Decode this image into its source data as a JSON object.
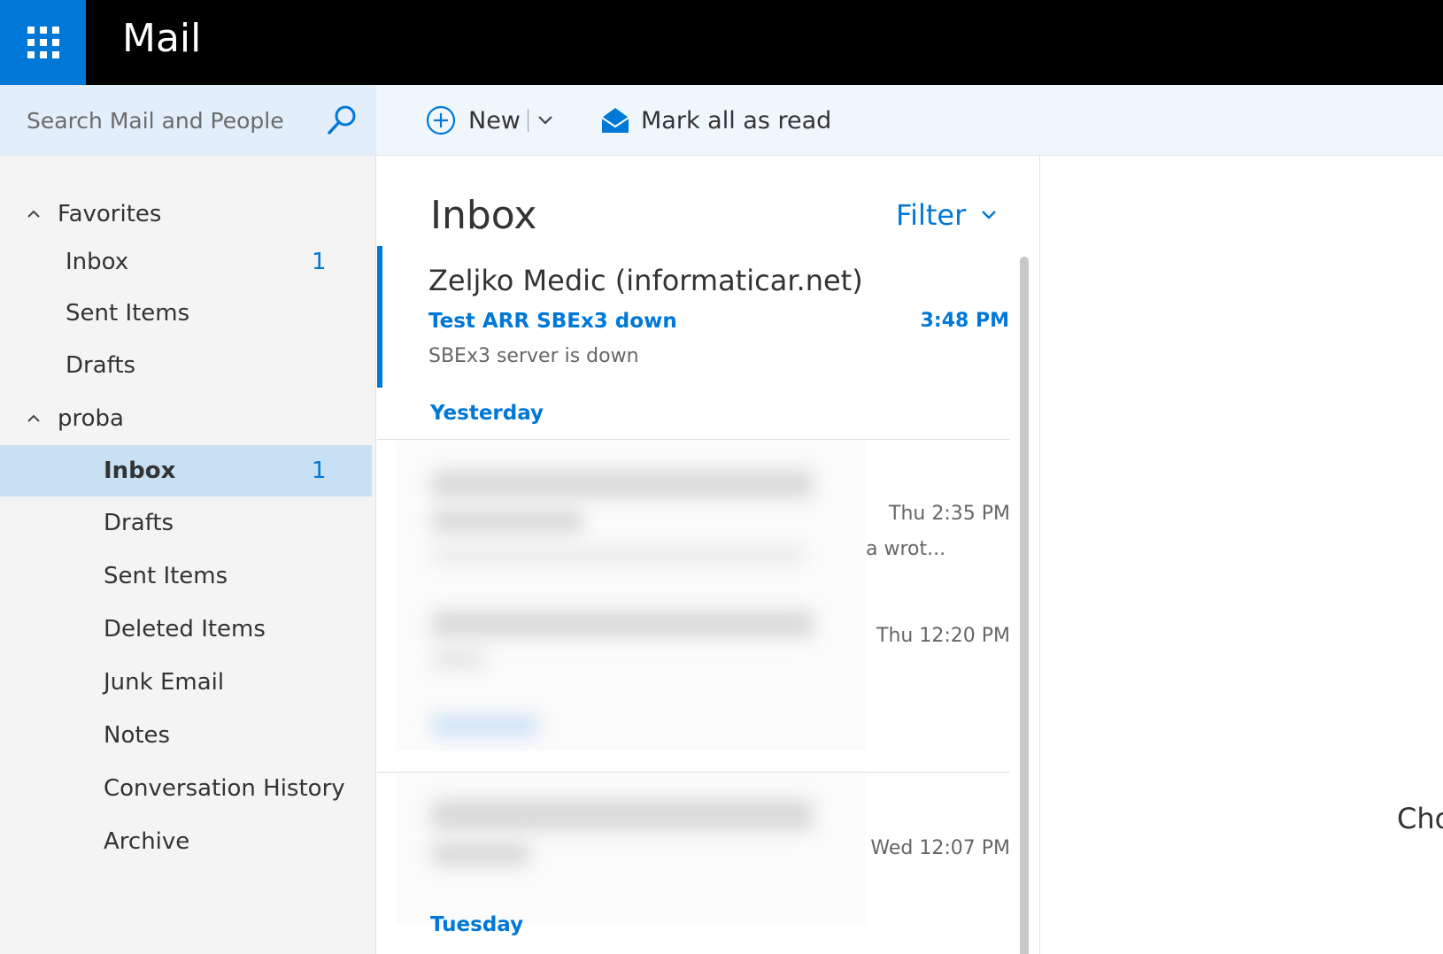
{
  "app": {
    "title": "Mail"
  },
  "search": {
    "placeholder": "Search Mail and People"
  },
  "toolbar": {
    "new_label": "New",
    "mark_all_label": "Mark all as read"
  },
  "nav": {
    "sections": [
      {
        "label": "Favorites",
        "items": [
          {
            "label": "Inbox",
            "count": "1"
          },
          {
            "label": "Sent Items",
            "count": ""
          },
          {
            "label": "Drafts",
            "count": ""
          }
        ]
      },
      {
        "label": "proba",
        "items": [
          {
            "label": "Inbox",
            "count": "1",
            "selected": true
          },
          {
            "label": "Drafts",
            "count": ""
          },
          {
            "label": "Sent Items",
            "count": ""
          },
          {
            "label": "Deleted Items",
            "count": ""
          },
          {
            "label": "Junk Email",
            "count": ""
          },
          {
            "label": "Notes",
            "count": ""
          },
          {
            "label": "Conversation History",
            "count": ""
          },
          {
            "label": "Archive",
            "count": ""
          }
        ]
      }
    ]
  },
  "list": {
    "title": "Inbox",
    "filter_label": "Filter",
    "selected_message": {
      "from": "Zeljko Medic (informaticar.net)",
      "subject": "Test ARR SBEx3 down",
      "time": "3:48 PM",
      "preview": "SBEx3 server is down"
    },
    "groups": [
      {
        "label": "Yesterday",
        "messages": [
          {
            "time": "Thu 2:35 PM",
            "preview_tail": "a wrot..."
          },
          {
            "time": "Thu 12:20 PM",
            "preview_tail": ""
          }
        ]
      },
      {
        "label": "",
        "messages": [
          {
            "time": "Wed 12:07 PM",
            "preview_tail": ""
          }
        ]
      },
      {
        "label": "Tuesday",
        "messages": []
      }
    ]
  },
  "reading_pane": {
    "text": "Cho"
  },
  "colors": {
    "accent": "#0078d7",
    "header_bg": "#000000",
    "selected_bg": "#c7e0f4",
    "search_bg": "#e2eef9"
  }
}
